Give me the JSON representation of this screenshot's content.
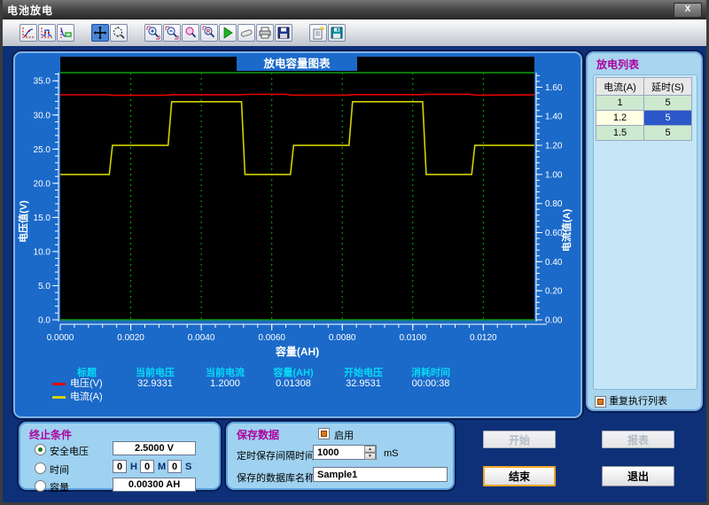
{
  "window": {
    "title": "电池放电",
    "close_label": "X"
  },
  "toolbar": {
    "icons": [
      "waveform-plot-icon",
      "waveform-step-icon",
      "waveform-config-icon",
      "pan-crosshair-icon",
      "zoom-track-icon",
      "zoom-in-icon",
      "zoom-out-icon",
      "zoom-window-icon",
      "zoom-reset-icon",
      "play-icon",
      "eraser-icon",
      "printer-icon",
      "save-icon",
      "report-doc-icon",
      "database-save-icon"
    ]
  },
  "chart": {
    "legend_headers": [
      "标题",
      "当前电压",
      "当前电流",
      "容量(AH)",
      "开始电压",
      "消耗时间"
    ],
    "legend_values": [
      "32.9331",
      "1.2000",
      "0.01308",
      "32.9531",
      "00:00:38"
    ],
    "series_labels": [
      "电压(V)",
      "电流(A)"
    ],
    "series_colors": [
      "#e40000",
      "#d2d200"
    ]
  },
  "chart_data": {
    "type": "line",
    "title": "放电容量图表",
    "xlabel": "容量(AH)",
    "ylabel_left": "电压值(V)",
    "ylabel_right": "电流值(A)",
    "xlim": [
      0,
      0.01345
    ],
    "ylim_left": [
      0,
      36.2
    ],
    "ylim_right": [
      0,
      1.7
    ],
    "grid": {
      "vertical": true,
      "horizontal": false,
      "color": "#00b400",
      "style": "dashed"
    },
    "x_major_ticks": [
      {
        "v": 0,
        "label": "0.0000"
      },
      {
        "v": 0.002,
        "label": "0.0020"
      },
      {
        "v": 0.004,
        "label": "0.0040"
      },
      {
        "v": 0.006,
        "label": "0.0060"
      },
      {
        "v": 0.008,
        "label": "0.0080"
      },
      {
        "v": 0.01,
        "label": "0.0100"
      },
      {
        "v": 0.012,
        "label": "0.0120"
      }
    ],
    "x_minor_step": 0.0004,
    "left_major_ticks": [
      {
        "v": 0,
        "label": "0.0"
      },
      {
        "v": 5,
        "label": "5.0"
      },
      {
        "v": 10,
        "label": "10.0"
      },
      {
        "v": 15,
        "label": "15.0"
      },
      {
        "v": 20,
        "label": "20.0"
      },
      {
        "v": 25,
        "label": "25.0"
      },
      {
        "v": 30,
        "label": "30.0"
      },
      {
        "v": 35,
        "label": "35.0"
      }
    ],
    "left_minor_step": 1,
    "right_major_ticks": [
      {
        "v": 0,
        "label": "0.00"
      },
      {
        "v": 0.2,
        "label": "0.20"
      },
      {
        "v": 0.4,
        "label": "0.40"
      },
      {
        "v": 0.6,
        "label": "0.60"
      },
      {
        "v": 0.8,
        "label": "0.80"
      },
      {
        "v": 1.0,
        "label": "1.00"
      },
      {
        "v": 1.2,
        "label": "1.20"
      },
      {
        "v": 1.4,
        "label": "1.40"
      },
      {
        "v": 1.6,
        "label": "1.60"
      }
    ],
    "right_minor_step": 0.04,
    "series": [
      {
        "name": "电压(V)",
        "axis": "left",
        "color": "#e40000",
        "points": [
          [
            0,
            32.95
          ],
          [
            0.0013,
            32.95
          ],
          [
            0.0015,
            32.88
          ],
          [
            0.003,
            32.9
          ],
          [
            0.0032,
            32.97
          ],
          [
            0.0051,
            32.97
          ],
          [
            0.0053,
            33.02
          ],
          [
            0.0064,
            33.02
          ],
          [
            0.0066,
            32.9
          ],
          [
            0.0081,
            32.9
          ],
          [
            0.0083,
            32.98
          ],
          [
            0.0102,
            32.98
          ],
          [
            0.0104,
            33.03
          ],
          [
            0.0116,
            33.03
          ],
          [
            0.0118,
            32.9
          ],
          [
            0.01345,
            32.94
          ]
        ]
      },
      {
        "name": "电流(A)",
        "axis": "right",
        "color": "#d2d200",
        "points": [
          [
            0,
            1.0
          ],
          [
            0.00139,
            1.0
          ],
          [
            0.00148,
            1.2
          ],
          [
            0.00306,
            1.2
          ],
          [
            0.00316,
            1.5
          ],
          [
            0.00514,
            1.5
          ],
          [
            0.00524,
            1.0
          ],
          [
            0.00653,
            1.0
          ],
          [
            0.00662,
            1.2
          ],
          [
            0.00819,
            1.2
          ],
          [
            0.00829,
            1.5
          ],
          [
            0.01028,
            1.5
          ],
          [
            0.01038,
            1.0
          ],
          [
            0.01167,
            1.0
          ],
          [
            0.01176,
            1.2
          ],
          [
            0.01345,
            1.2
          ]
        ]
      }
    ]
  },
  "discharge_list": {
    "title": "放电列表",
    "headers": [
      "电流(A)",
      "延时(S)"
    ],
    "rows": [
      [
        "1",
        "5"
      ],
      [
        "1.2",
        "5"
      ],
      [
        "1.5",
        "5"
      ]
    ],
    "selected_row": 1,
    "repeat_label": "重复执行列表",
    "repeat_checked": true
  },
  "stop_conditions": {
    "title": "终止条件",
    "options": [
      {
        "label": "安全电压",
        "selected": true,
        "value": "2.5000 V"
      },
      {
        "label": "时间",
        "selected": false
      },
      {
        "label": "容量",
        "selected": false,
        "value": "0.00300 AH"
      }
    ],
    "time": {
      "h": "0",
      "h_label": "H",
      "m": "0",
      "m_label": "M",
      "s": "0",
      "s_label": "S"
    }
  },
  "save_data": {
    "title": "保存数据",
    "enable_label": "启用",
    "enable_checked": true,
    "interval_label": "定时保存间隔时间",
    "interval_value": "1000",
    "interval_unit": "mS",
    "dbname_label": "保存的数据库名称",
    "dbname_value": "Sample1"
  },
  "buttons": {
    "start": "开始",
    "report": "报表",
    "stop": "结束",
    "exit": "退出"
  }
}
